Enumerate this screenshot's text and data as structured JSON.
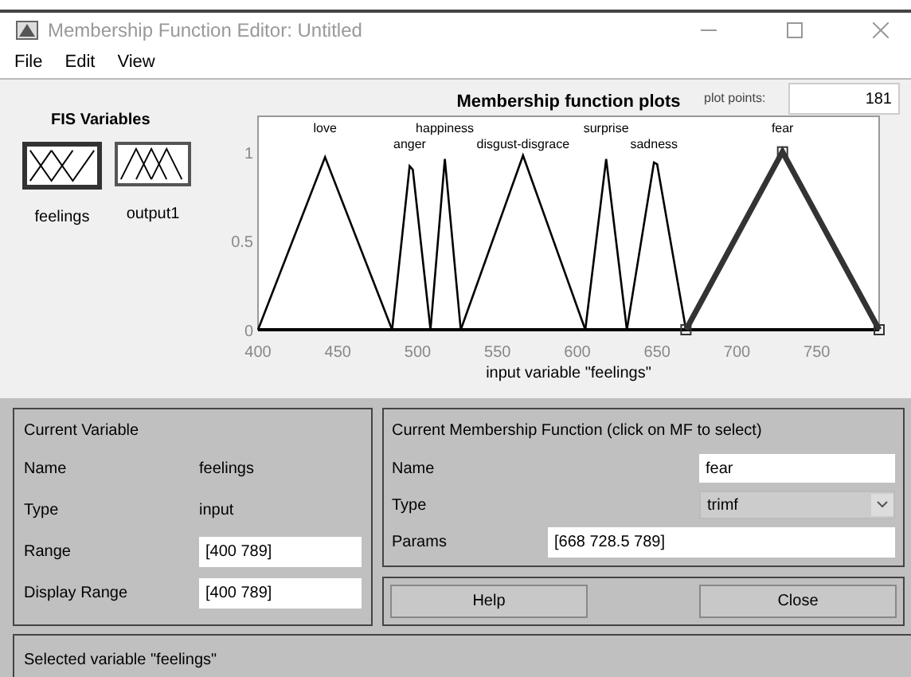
{
  "window": {
    "title": "Membership Function Editor: Untitled"
  },
  "menu": [
    "File",
    "Edit",
    "View"
  ],
  "fis_variables": {
    "title": "FIS Variables",
    "items": [
      {
        "label": "feelings",
        "kind": "input",
        "selected": true
      },
      {
        "label": "output1",
        "kind": "output",
        "selected": false
      }
    ]
  },
  "plot": {
    "plot_points_label": "plot points:",
    "plot_points": "181",
    "chart_data": {
      "type": "line",
      "title": "Membership function plots",
      "xlabel": "input variable \"feelings\"",
      "xlim": [
        400,
        789
      ],
      "ylim": [
        0,
        1.2
      ],
      "xticks": [
        400,
        450,
        500,
        550,
        600,
        650,
        700,
        750
      ],
      "yticks": [
        0,
        0.5,
        1
      ],
      "series": [
        {
          "name": "love",
          "x": [
            400,
            442,
            484
          ],
          "values": [
            0,
            0.97,
            0
          ]
        },
        {
          "name": "anger",
          "x": [
            484,
            495,
            497,
            508
          ],
          "values": [
            0,
            0.92,
            0.9,
            0
          ]
        },
        {
          "name": "happiness",
          "x": [
            508,
            517,
            527
          ],
          "values": [
            0,
            0.96,
            0
          ]
        },
        {
          "name": "disgust-disgrace",
          "x": [
            527,
            566,
            605
          ],
          "values": [
            0,
            0.98,
            0
          ]
        },
        {
          "name": "surprise",
          "x": [
            605,
            618,
            631
          ],
          "values": [
            0,
            0.96,
            0
          ]
        },
        {
          "name": "sadness",
          "x": [
            631,
            648,
            650,
            668
          ],
          "values": [
            0,
            0.94,
            0.93,
            0
          ]
        },
        {
          "name": "fear",
          "x": [
            668,
            728.5,
            789
          ],
          "values": [
            0,
            1,
            0
          ]
        }
      ]
    },
    "mf_lines": [
      {
        "selected": false
      },
      {
        "selected": false
      },
      {
        "selected": false
      },
      {
        "selected": false
      },
      {
        "selected": false
      },
      {
        "selected": false
      },
      {
        "selected": true
      }
    ]
  },
  "current_variable": {
    "title": "Current Variable",
    "rows": [
      {
        "label": "Name",
        "value": "feelings",
        "kind": "text"
      },
      {
        "label": "Type",
        "value": "input",
        "kind": "text"
      },
      {
        "label": "Range",
        "value": "[400 789]",
        "kind": "field"
      },
      {
        "label": "Display Range",
        "value": "[400 789]",
        "kind": "field"
      }
    ]
  },
  "current_mf": {
    "title": "Current Membership Function (click on MF to select)",
    "name_label": "Name",
    "name": "fear",
    "type_label": "Type",
    "type": "trimf",
    "params_label": "Params",
    "params": "[668 728.5 789]"
  },
  "buttons": [
    "Help",
    "Close"
  ],
  "status_bar": "Selected variable \"feelings\""
}
